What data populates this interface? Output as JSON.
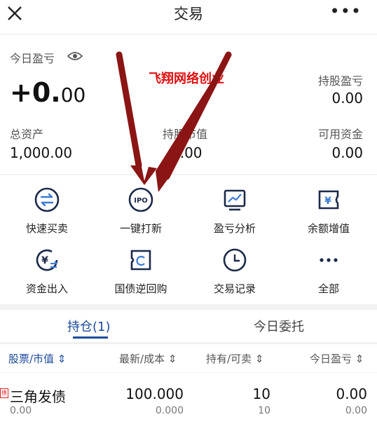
{
  "nav": {
    "title": "交易",
    "more": "•••"
  },
  "summary": {
    "today_pnl_label": "今日盈亏",
    "today_pnl_int": "+0.",
    "today_pnl_dec": "00",
    "holding_pnl_label": "持股盈亏",
    "holding_pnl_value": "0.00",
    "total_assets_label": "总资产",
    "total_assets_value": "1,000.00",
    "market_value_label": "持股市值",
    "market_value_value": "0.00",
    "available_label": "可用资金",
    "available_value": "0.00"
  },
  "watermark": "飞翔网络创业",
  "actions": [
    {
      "label": "快速买卖",
      "icon": "swap-icon"
    },
    {
      "label": "一键打新",
      "icon": "ipo-icon"
    },
    {
      "label": "盈亏分析",
      "icon": "chart-icon"
    },
    {
      "label": "余额增值",
      "icon": "yen-card-icon"
    },
    {
      "label": "资金出入",
      "icon": "yen-transfer-icon"
    },
    {
      "label": "国债逆回购",
      "icon": "reverse-repo-icon"
    },
    {
      "label": "交易记录",
      "icon": "clock-icon"
    },
    {
      "label": "全部",
      "icon": "more-icon"
    }
  ],
  "tabs": {
    "holdings": "持仓(1)",
    "orders": "今日委托"
  },
  "table": {
    "headers": [
      "股票/市值",
      "最新/成本",
      "持有/可卖",
      "今日盈亏"
    ],
    "rows": [
      {
        "badge": "债",
        "name": "三角发债",
        "market_value": "0.00",
        "latest": "100.000",
        "cost": "0.000",
        "hold": "10",
        "sellable": "10",
        "today_pnl": "0.00",
        "today_pnl_sub": "0.00"
      }
    ]
  },
  "colors": {
    "accent": "#1c4a9c",
    "watermark": "#e01010",
    "arrow": "#8b1414"
  }
}
